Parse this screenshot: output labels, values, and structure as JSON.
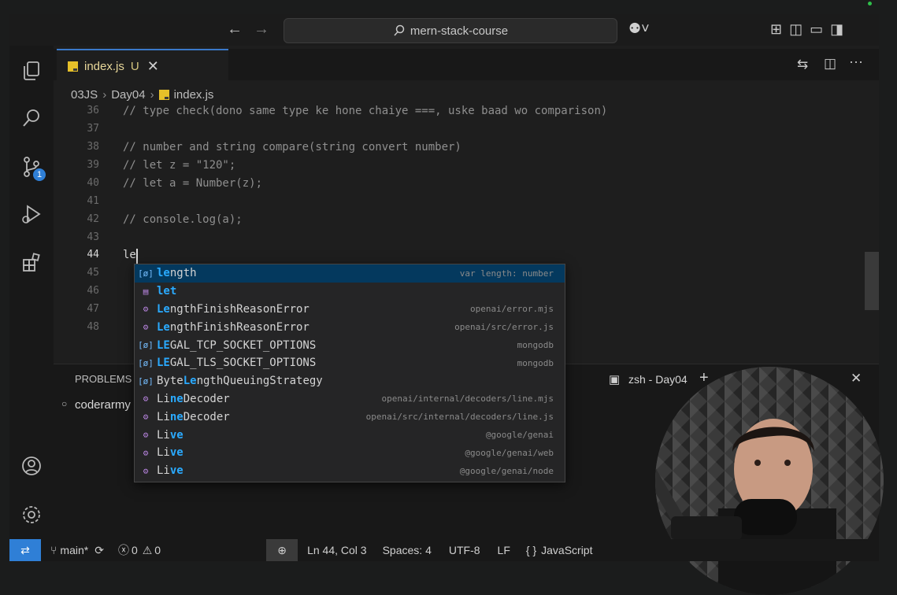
{
  "titlebar": {
    "search_text": "mern-stack-course"
  },
  "tab": {
    "filename": "index.js",
    "status": "U"
  },
  "breadcrumb": [
    "03JS",
    "Day04",
    "index.js"
  ],
  "editor": {
    "lines": [
      {
        "n": "36",
        "text": "// type check(dono same type ke hone chaiye ===, uske baad wo comparison)"
      },
      {
        "n": "37",
        "text": ""
      },
      {
        "n": "38",
        "text": "// number and string compare(string convert number)"
      },
      {
        "n": "39",
        "text": "// let z = \"120\";"
      },
      {
        "n": "40",
        "text": "// let a = Number(z);"
      },
      {
        "n": "41",
        "text": ""
      },
      {
        "n": "42",
        "text": "// console.log(a);"
      },
      {
        "n": "43",
        "text": ""
      },
      {
        "n": "44",
        "text": "le"
      },
      {
        "n": "45",
        "text": ""
      },
      {
        "n": "46",
        "text": ""
      },
      {
        "n": "47",
        "text": ""
      },
      {
        "n": "48",
        "text": ""
      }
    ]
  },
  "suggestions": [
    {
      "icon": "[ø]",
      "kind": "var",
      "hl": "le",
      "rest": "ngth",
      "detail": "var length: number",
      "selected": true
    },
    {
      "icon": "▤",
      "kind": "kw",
      "hl": "let",
      "rest": "",
      "detail": ""
    },
    {
      "icon": "⚙",
      "kind": "cls",
      "hl": "Le",
      "rest": "ngthFinishReasonError",
      "detail": "openai/error.mjs"
    },
    {
      "icon": "⚙",
      "kind": "cls",
      "hl": "Le",
      "rest": "ngthFinishReasonError",
      "detail": "openai/src/error.js"
    },
    {
      "icon": "[ø]",
      "kind": "var",
      "hl": "LE",
      "rest": "GAL_TCP_SOCKET_OPTIONS",
      "detail": "mongodb"
    },
    {
      "icon": "[ø]",
      "kind": "var",
      "hl": "LE",
      "rest": "GAL_TLS_SOCKET_OPTIONS",
      "detail": "mongodb"
    },
    {
      "icon": "[ø]",
      "kind": "var",
      "pre": "Byte",
      "hl": "Le",
      "rest": "ngthQueuingStrategy",
      "detail": ""
    },
    {
      "icon": "⚙",
      "kind": "cls",
      "pre": "Li",
      "hl": "ne",
      "rest": "Decoder",
      "detail": "openai/internal/decoders/line.mjs"
    },
    {
      "icon": "⚙",
      "kind": "cls",
      "pre": "Li",
      "hl": "ne",
      "rest": "Decoder",
      "detail": "openai/src/internal/decoders/line.js"
    },
    {
      "icon": "⚙",
      "kind": "cls",
      "pre": "Li",
      "hl": "ve",
      "rest": "",
      "detail": "@google/genai"
    },
    {
      "icon": "⚙",
      "kind": "cls",
      "pre": "Li",
      "hl": "ve",
      "rest": "",
      "detail": "@google/genai/web"
    },
    {
      "icon": "⚙",
      "kind": "cls",
      "pre": "Li",
      "hl": "ve",
      "rest": "",
      "detail": "@google/genai/node"
    }
  ],
  "panel": {
    "tab_label": "PROBLEMS",
    "terminal_label": "zsh - Day04",
    "prompt_text": "coderarmy"
  },
  "scm_badge": "1",
  "status": {
    "branch": "main*",
    "errors": "0",
    "warnings": "0",
    "position": "Ln 44, Col 3",
    "spaces": "Spaces: 4",
    "encoding": "UTF-8",
    "eol": "LF",
    "language": "JavaScript"
  }
}
